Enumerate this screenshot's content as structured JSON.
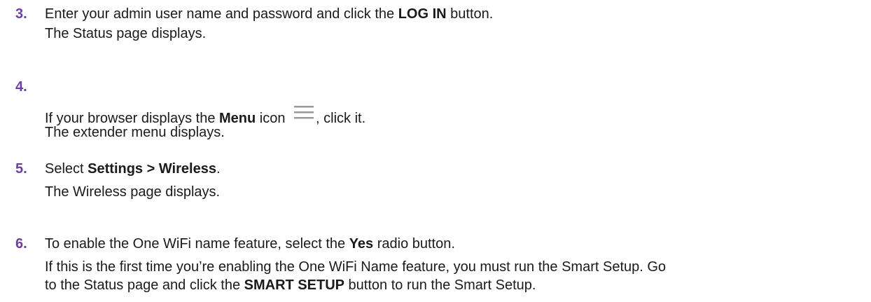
{
  "steps": [
    {
      "number": "3.",
      "lines": [
        {
          "parts": [
            "Enter your admin user name and password and click the ",
            "LOG IN",
            " button."
          ]
        },
        {
          "text": "The Status page displays."
        }
      ]
    },
    {
      "number": "4.",
      "lines": [
        {
          "parts": [
            "If your browser displays the ",
            "Menu",
            " icon ",
            ", click it."
          ],
          "icon": "hamburger-menu-icon"
        },
        {
          "text": "The extender menu displays."
        }
      ]
    },
    {
      "number": "5.",
      "lines": [
        {
          "parts": [
            "Select ",
            "Settings > Wireless",
            "."
          ]
        },
        {
          "text": "The Wireless page displays."
        }
      ]
    },
    {
      "number": "6.",
      "lines": [
        {
          "parts": [
            "To enable the One WiFi name feature, select the ",
            "Yes",
            " radio button."
          ]
        },
        {
          "text": "If this is the first time you’re enabling the One WiFi Name feature, you must run the Smart Setup. Go"
        },
        {
          "parts": [
            "to the Status page and click the ",
            "SMART SETUP",
            " button to run the Smart Setup."
          ]
        }
      ]
    }
  ],
  "colors": {
    "step_number": "#6b3fa0",
    "text": "#1a1a1a",
    "icon": "#9a9a9a"
  }
}
